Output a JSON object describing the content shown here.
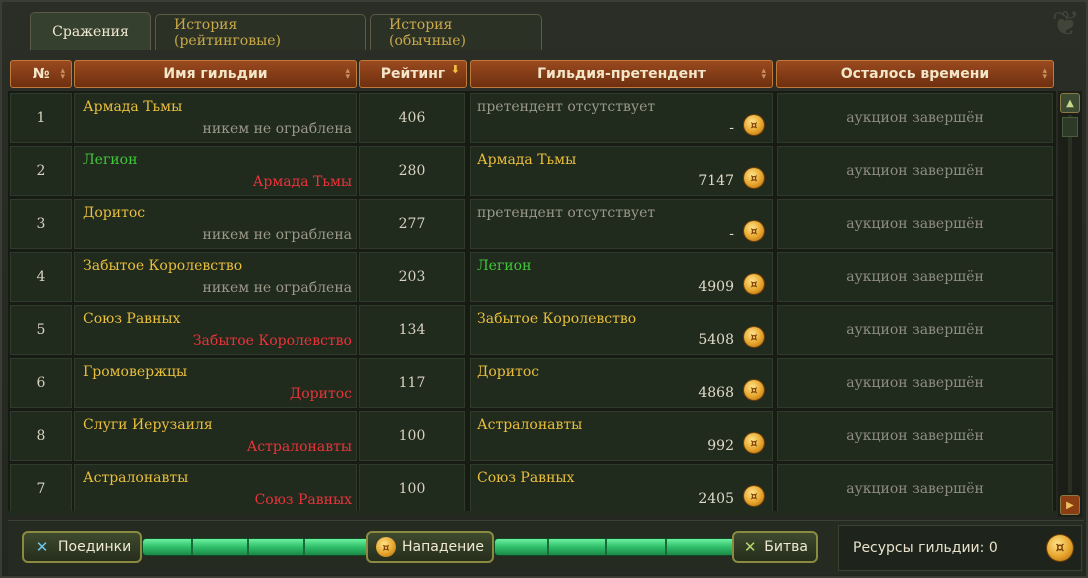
{
  "tabs": [
    {
      "label": "Сражения",
      "active": true
    },
    {
      "label": "История (рейтинговые)",
      "active": false
    },
    {
      "label": "История (обычные)",
      "active": false
    }
  ],
  "columns": {
    "num": "№",
    "guild": "Имя гильдии",
    "rating": "Рейтинг",
    "challenger": "Гильдия-претендент",
    "time": "Осталось времени"
  },
  "rows": [
    {
      "num": "1",
      "guild": "Армада Тьмы",
      "guild_color": "yellow",
      "robbed": "никем не ограблена",
      "robbed_state": "none",
      "rating": "406",
      "challenger": "претендент отсутствует",
      "challenger_color": "none",
      "bid": "-",
      "time": "аукцион завершён"
    },
    {
      "num": "2",
      "guild": "Легион",
      "guild_color": "green",
      "robbed": "Армада Тьмы",
      "robbed_state": "red",
      "rating": "280",
      "challenger": "Армада Тьмы",
      "challenger_color": "yellow",
      "bid": "7147",
      "time": "аукцион завершён"
    },
    {
      "num": "3",
      "guild": "Доритос",
      "guild_color": "yellow",
      "robbed": "никем не ограблена",
      "robbed_state": "none",
      "rating": "277",
      "challenger": "претендент отсутствует",
      "challenger_color": "none",
      "bid": "-",
      "time": "аукцион завершён"
    },
    {
      "num": "4",
      "guild": "Забытое Королевство",
      "guild_color": "yellow",
      "robbed": "никем не ограблена",
      "robbed_state": "none",
      "rating": "203",
      "challenger": "Легион",
      "challenger_color": "green",
      "bid": "4909",
      "time": "аукцион завершён"
    },
    {
      "num": "5",
      "guild": "Союз Равных",
      "guild_color": "yellow",
      "robbed": "Забытое Королевство",
      "robbed_state": "red",
      "rating": "134",
      "challenger": "Забытое Королевство",
      "challenger_color": "yellow",
      "bid": "5408",
      "time": "аукцион завершён"
    },
    {
      "num": "6",
      "guild": "Громовержцы",
      "guild_color": "yellow",
      "robbed": "Доритос",
      "robbed_state": "red",
      "rating": "117",
      "challenger": "Доритос",
      "challenger_color": "yellow",
      "bid": "4868",
      "time": "аукцион завершён"
    },
    {
      "num": "8",
      "guild": "Слуги Иерузаиля",
      "guild_color": "yellow",
      "robbed": "Астралонавты",
      "robbed_state": "red",
      "rating": "100",
      "challenger": "Астралонавты",
      "challenger_color": "yellow",
      "bid": "992",
      "time": "аукцион завершён"
    },
    {
      "num": "7",
      "guild": "Астралонавты",
      "guild_color": "yellow",
      "robbed": "Союз Равных",
      "robbed_state": "red",
      "rating": "100",
      "challenger": "Союз Равных",
      "challenger_color": "yellow",
      "bid": "2405",
      "time": "аукцион завершён"
    }
  ],
  "bottom": {
    "duels_label": "Поединки",
    "attack_label": "Нападение",
    "battle_label": "Битва",
    "resources_label": "Ресурсы гильдии: 0"
  },
  "icons": {
    "coin": "gold-coin-icon",
    "swords": "crossed-swords-icon",
    "sort_active": "sort-desc-icon",
    "sort": "sort-icon"
  },
  "colors": {
    "header": "#9a4a1e",
    "guild_default": "#e9bf3c",
    "guild_green": "#41c83a",
    "robbed_red": "#e8343a",
    "muted": "#9a9889"
  }
}
